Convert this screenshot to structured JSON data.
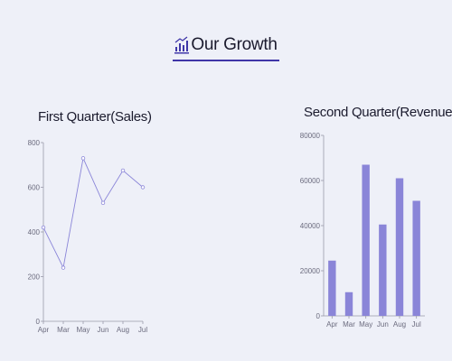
{
  "header": {
    "title": "Our Growth",
    "icon": "bar-chart-logo-icon",
    "accent": "#3f36a8"
  },
  "chart_data": [
    {
      "type": "line",
      "title": "First Quarter(Sales)",
      "categories": [
        "Apr",
        "Mar",
        "May",
        "Jun",
        "Aug",
        "Jul"
      ],
      "values": [
        420,
        240,
        730,
        530,
        675,
        600
      ],
      "ylim": [
        0,
        800
      ],
      "yticks": [
        "0",
        "200",
        "400",
        "600",
        "800"
      ],
      "xlabel": "",
      "ylabel": "",
      "grid": false,
      "color": "#8a85d8"
    },
    {
      "type": "bar",
      "title": "Second Quarter(Revenue)",
      "categories": [
        "Apr",
        "Mar",
        "May",
        "Jun",
        "Aug",
        "Jul"
      ],
      "values": [
        24500,
        10500,
        67000,
        40500,
        61000,
        51000
      ],
      "ylim": [
        0,
        80000
      ],
      "yticks": [
        "0",
        "20000",
        "40000",
        "60000",
        "80000"
      ],
      "xlabel": "",
      "ylabel": "",
      "grid": false,
      "color": "#8a85d8"
    }
  ]
}
